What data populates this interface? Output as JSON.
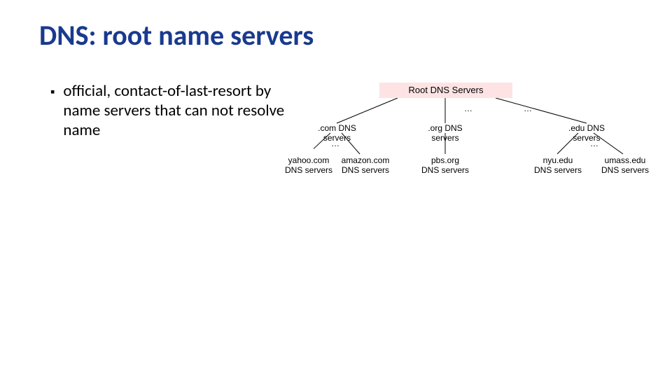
{
  "title": "DNS: root name servers",
  "bullet": "official, contact-of-last-resort by name servers that can not resolve name",
  "diagram": {
    "root": "Root DNS Servers",
    "ell1": "…",
    "ell2": "…",
    "tld": {
      "com": ".com DNS servers",
      "org": ".org DNS servers",
      "edu": ".edu DNS servers"
    },
    "leaf": {
      "yahoo_l1": "yahoo.com",
      "yahoo_l2": "DNS servers",
      "amazon_l1": "amazon.com",
      "amazon_l2": "DNS servers",
      "pbs_l1": "pbs.org",
      "pbs_l2": "DNS servers",
      "nyu_l1": "nyu.edu",
      "nyu_l2": "DNS servers",
      "umass_l1": "umass.edu",
      "umass_l2": "DNS servers"
    },
    "ell3": "…",
    "ell4": "…"
  }
}
